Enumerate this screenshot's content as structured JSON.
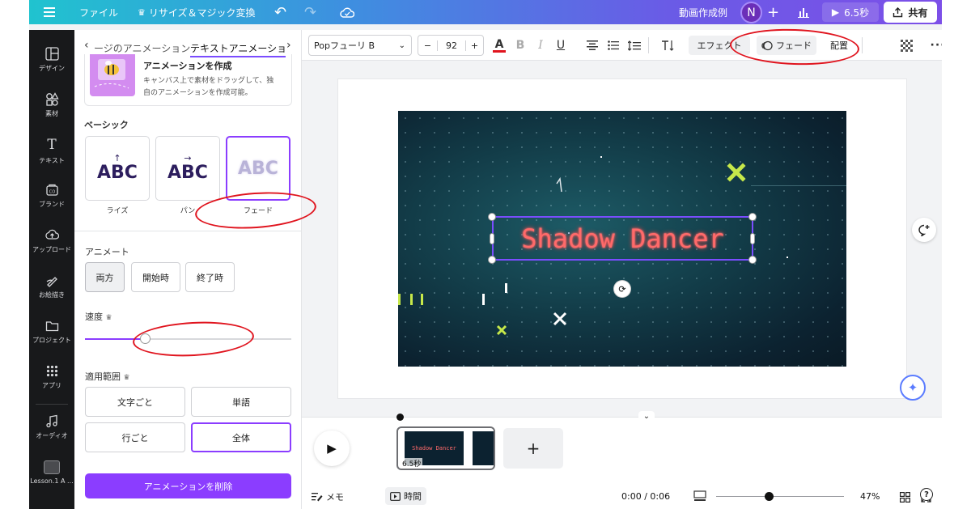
{
  "topbar": {
    "file_label": "ファイル",
    "resize_label": "リサイズ＆マジック変換",
    "project_title": "動画作成例",
    "avatar_initial": "N",
    "duration_label": "6.5秒",
    "share_label": "共有"
  },
  "rail": {
    "items": [
      {
        "label": "デザイン",
        "icon": "layout-icon"
      },
      {
        "label": "素材",
        "icon": "elements-icon"
      },
      {
        "label": "テキスト",
        "icon": "text-icon"
      },
      {
        "label": "ブランド",
        "icon": "brand-icon"
      },
      {
        "label": "アップロード",
        "icon": "upload-icon"
      },
      {
        "label": "お絵描き",
        "icon": "draw-icon"
      },
      {
        "label": "プロジェクト",
        "icon": "folder-icon"
      },
      {
        "label": "アプリ",
        "icon": "apps-icon"
      },
      {
        "label": "オーディオ",
        "icon": "music-icon"
      },
      {
        "label": "Lesson.1 A ...",
        "icon": "lesson-thumbnail"
      }
    ]
  },
  "panel": {
    "tab_page": "ージのアニメーション",
    "tab_text": "テキストアニメーショ",
    "create_title": "アニメーションを作成",
    "create_desc_1": "キャンバス上で素材をドラッグして、独",
    "create_desc_2": "自のアニメーションを作成可能。",
    "basic_label": "ベーシック",
    "tiles": [
      {
        "text": "ABC",
        "caption": "ライズ",
        "arrow": "↑"
      },
      {
        "text": "ABC",
        "caption": "パン",
        "arrow": "→"
      },
      {
        "text": "ABC",
        "caption": "フェード",
        "arrow": ""
      }
    ],
    "animate_label": "アニメート",
    "animate_options": [
      "両方",
      "開始時",
      "終了時"
    ],
    "speed_label": "速度",
    "speed_value": 0.29,
    "scope_label": "適用範囲",
    "scope_options": [
      "文字ごと",
      "単語",
      "行ごと",
      "全体"
    ],
    "delete_label": "アニメーションを削除"
  },
  "format": {
    "font_name": "Popフューリ B",
    "font_size": "92",
    "minus": "−",
    "plus": "+",
    "effects_label": "エフェクト",
    "fade_label": "フェード",
    "arrange_label": "配置",
    "text_color": "#e0141e"
  },
  "canvas": {
    "title_text": "Shadow Dancer",
    "accent_yellow": "#c6e84a"
  },
  "timeline": {
    "thumb_duration": "6.5秒",
    "thumb_text": "Shadow Dancer",
    "memo_label": "メモ",
    "time_label": "時間",
    "timecode": "0:00 / 0:06",
    "zoom": "47%",
    "zoom_value": 0.41,
    "help": "?"
  }
}
